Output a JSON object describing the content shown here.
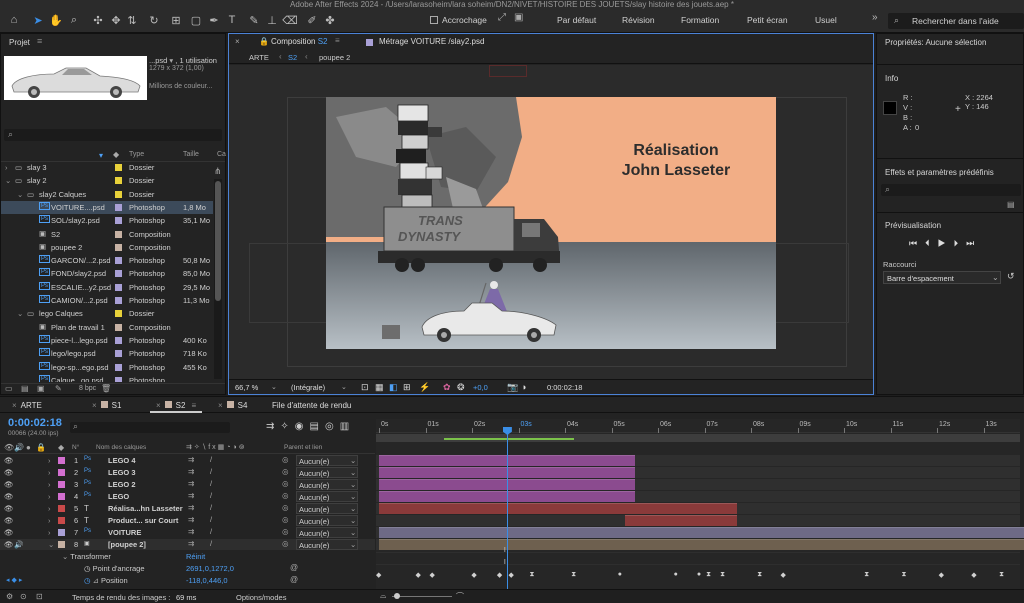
{
  "app": {
    "title": "Adobe After Effects 2024 - /Users/larasoheim/lara soheim/DN2/NIVET/HISTOIRE DES JOUETS/slay histoire des jouets.aep *",
    "snap_label": "Accrochage",
    "workspaces": [
      "Par défaut",
      "Révision",
      "Formation",
      "Petit écran",
      "Usuel"
    ],
    "search_placeholder": "Rechercher dans l'aide"
  },
  "project": {
    "title": "Projet",
    "asset_name": "...psd",
    "asset_usage": ", 1 utilisation",
    "asset_dims": "1279 x 372 (1,00)",
    "asset_colors": "Millions de couleur...",
    "col_type": "Type",
    "col_size": "Taille",
    "col_ca": "Ca",
    "items": [
      {
        "name": "slay 3",
        "type": "Dossier",
        "size": "",
        "color": "#e8d13a",
        "indent": 0,
        "kind": "folder",
        "open": false
      },
      {
        "name": "slay 2",
        "type": "Dossier",
        "size": "",
        "color": "#e8d13a",
        "indent": 0,
        "kind": "folder",
        "open": true
      },
      {
        "name": "slay2 Calques",
        "type": "Dossier",
        "size": "",
        "color": "#e8d13a",
        "indent": 1,
        "kind": "folder",
        "open": true
      },
      {
        "name": "VOITURE....psd",
        "type": "Photoshop",
        "size": "1,8 Mo",
        "color": "#a9a0d6",
        "indent": 2,
        "kind": "psd",
        "selected": true
      },
      {
        "name": "SOL/slay2.psd",
        "type": "Photoshop",
        "size": "35,1 Mo",
        "color": "#a9a0d6",
        "indent": 2,
        "kind": "psd"
      },
      {
        "name": "S2",
        "type": "Composition",
        "size": "",
        "color": "#c7b2a4",
        "indent": 2,
        "kind": "comp"
      },
      {
        "name": "poupee 2",
        "type": "Composition",
        "size": "",
        "color": "#c7b2a4",
        "indent": 2,
        "kind": "comp"
      },
      {
        "name": "GARCON/...2.psd",
        "type": "Photoshop",
        "size": "50,8 Mo",
        "color": "#a9a0d6",
        "indent": 2,
        "kind": "psd"
      },
      {
        "name": "FOND/slay2.psd",
        "type": "Photoshop",
        "size": "85,0 Mo",
        "color": "#a9a0d6",
        "indent": 2,
        "kind": "psd"
      },
      {
        "name": "ESCALIE...y2.psd",
        "type": "Photoshop",
        "size": "29,5 Mo",
        "color": "#a9a0d6",
        "indent": 2,
        "kind": "psd"
      },
      {
        "name": "CAMION/...2.psd",
        "type": "Photoshop",
        "size": "11,3 Mo",
        "color": "#a9a0d6",
        "indent": 2,
        "kind": "psd"
      },
      {
        "name": "lego Calques",
        "type": "Dossier",
        "size": "",
        "color": "#e8d13a",
        "indent": 1,
        "kind": "folder",
        "open": true
      },
      {
        "name": "Plan de travail 1",
        "type": "Composition",
        "size": "",
        "color": "#c7b2a4",
        "indent": 2,
        "kind": "comp"
      },
      {
        "name": "piece-l...lego.psd",
        "type": "Photoshop",
        "size": "400 Ko",
        "color": "#a9a0d6",
        "indent": 2,
        "kind": "psd"
      },
      {
        "name": "lego/lego.psd",
        "type": "Photoshop",
        "size": "718 Ko",
        "color": "#a9a0d6",
        "indent": 2,
        "kind": "psd"
      },
      {
        "name": "lego-sp...ego.psd",
        "type": "Photoshop",
        "size": "455 Ko",
        "color": "#a9a0d6",
        "indent": 2,
        "kind": "psd"
      },
      {
        "name": "Calque...go.psd",
        "type": "Photoshop",
        "size": "",
        "color": "#a9a0d6",
        "indent": 2,
        "kind": "psd"
      }
    ],
    "bpc": "8 bpc"
  },
  "viewer": {
    "tab_comp_prefix": "Composition",
    "tab_comp_name": "S2",
    "tab_footage_prefix": "Métrage",
    "tab_footage_name": "VOITURE /slay2.psd",
    "breadcrumbs": [
      "ARTE",
      "S2",
      "poupee 2"
    ],
    "title_line1": "Réalisation",
    "title_line2": "John Lasseter",
    "truck_text_1": "TRANS",
    "truck_text_2": "DYNASTY",
    "zoom": "66,7 %",
    "resolution": "(Intégrale)",
    "exposure": "+0,0",
    "timecode": "0:00:02:18"
  },
  "right": {
    "properties_title": "Propriétés: Aucune sélection",
    "info_title": "Info",
    "r_label": "R :",
    "v_label": "V :",
    "b_label": "B :",
    "a_label": "A :",
    "a_value": "0",
    "x_label": "X :",
    "x_value": "2264",
    "y_label": "Y :",
    "y_value": "146",
    "effects_title": "Effets et paramètres prédéfinis",
    "preview_title": "Prévisualisation",
    "shortcut_label": "Raccourci",
    "shortcut_value": "Barre d'espacement"
  },
  "timeline": {
    "tabs": [
      "ARTE",
      "S1",
      "S2",
      "S4"
    ],
    "render_queue": "File d'attente de rendu",
    "current_time": "0:00:02:18",
    "frame_info": "00066 (24.00 ips)",
    "col_n": "N°",
    "col_layer": "Nom des calques",
    "col_parent": "Parent et lien",
    "ruler": [
      "0s",
      "01s",
      "02s",
      "03s",
      "04s",
      "05s",
      "06s",
      "07s",
      "08s",
      "09s",
      "10s",
      "11s",
      "12s",
      "13s"
    ],
    "layers": [
      {
        "num": "1",
        "name": "LEGO 4",
        "kind": "psd",
        "color": "#d36fd0",
        "parent": "Aucun(e)",
        "bar_start": 0.0,
        "bar_end": 5.5,
        "bar_color": "#8b4b8f"
      },
      {
        "num": "2",
        "name": "LEGO 3",
        "kind": "psd",
        "color": "#d36fd0",
        "parent": "Aucun(e)",
        "bar_start": 0.0,
        "bar_end": 5.5,
        "bar_color": "#8b4b8f"
      },
      {
        "num": "3",
        "name": "LEGO 2",
        "kind": "psd",
        "color": "#d36fd0",
        "parent": "Aucun(e)",
        "bar_start": 0.0,
        "bar_end": 5.5,
        "bar_color": "#8b4b8f"
      },
      {
        "num": "4",
        "name": "LEGO",
        "kind": "psd",
        "color": "#d36fd0",
        "parent": "Aucun(e)",
        "bar_start": 0.0,
        "bar_end": 5.5,
        "bar_color": "#8b4b8f"
      },
      {
        "num": "5",
        "name": "Réalisa...hn Lasseter",
        "kind": "text",
        "color": "#c94a4a",
        "parent": "Aucun(e)",
        "bar_start": 0.0,
        "bar_end": 7.7,
        "bar_color": "#8a3a3a"
      },
      {
        "num": "6",
        "name": "Product... sur Court",
        "kind": "text",
        "color": "#c94a4a",
        "parent": "Aucun(e)",
        "bar_start": 5.3,
        "bar_end": 7.7,
        "bar_color": "#8a3a3a"
      },
      {
        "num": "7",
        "name": "VOITURE",
        "kind": "psd",
        "color": "#a9a0d6",
        "parent": "Aucun(e)",
        "bar_start": 0.0,
        "bar_end": 13.9,
        "bar_color": "#6e6a86"
      },
      {
        "num": "8",
        "name": "[poupee 2]",
        "kind": "comp",
        "color": "#c7b2a4",
        "parent": "Aucun(e)",
        "bar_start": 0.0,
        "bar_end": 13.9,
        "bar_color": "#6e604f",
        "open": true
      }
    ],
    "transform_label": "Transformer",
    "reset_label": "Réinit",
    "anchor_label": "Point d'ancrage",
    "anchor_value": "2691,0,1272,0",
    "position_label": "Position",
    "position_value": "-118,0,446,0",
    "render_time_label": "Temps de rendu des images :",
    "render_time_value": "69 ms",
    "options_label": "Options/modes",
    "playhead_seconds": 2.75,
    "work_area": [
      1.4,
      4.2
    ]
  }
}
